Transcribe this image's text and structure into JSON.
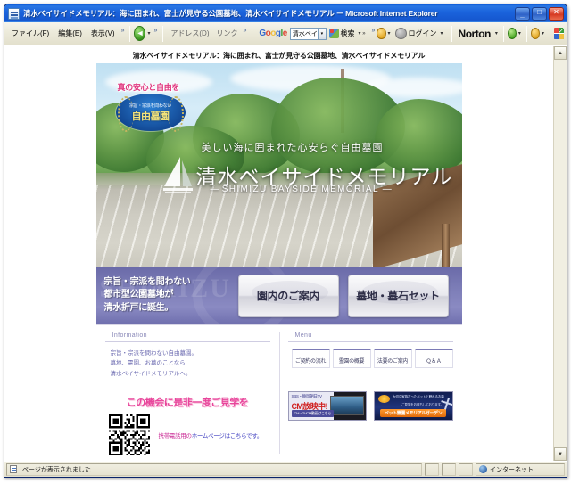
{
  "window": {
    "title": "清水ベイサイドメモリアル：海に囲まれ、富士が見守る公園墓地、清水ベイサイドメモリアル － Microsoft Internet Explorer",
    "minimize_label": "_",
    "maximize_label": "□",
    "close_label": "✕"
  },
  "toolbar": {
    "menus": [
      {
        "label": "ファイル(F)"
      },
      {
        "label": "編集(E)"
      },
      {
        "label": "表示(V)"
      }
    ],
    "menu_overflow": "»",
    "back_label": "◄",
    "back_dropdown": "▾",
    "address_label": "アドレス(D)",
    "links_label": "リンク",
    "address_overflow": "»",
    "google": {
      "logo": [
        "G",
        "o",
        "o",
        "g",
        "l",
        "e"
      ],
      "search_value": "清水ベイ",
      "search_dropdown": "▾",
      "search_button": "検索",
      "search_more": "▾ »",
      "tools_dropdown": "▾",
      "login_label": "ログイン",
      "login_dropdown": "▾"
    },
    "norton": {
      "label": "Norton",
      "dropdown": "▾",
      "status_dropdown": "▾",
      "identity_dropdown": "▾"
    }
  },
  "page": {
    "heading": "清水ベイサイドメモリアル：海に囲まれ、富士が見守る公園墓地、清水ベイサイドメモリアル",
    "hero": {
      "catch": "真の安心と自由を",
      "seal_line1": "宗旨・宗派を問わない",
      "seal_line2": "自由墓園",
      "subtitle": "美しい海に囲まれた心安らぐ自由墓園",
      "title": "清水ベイサイドメモリアル",
      "title_en": "SHIMIZU BAYSIDE MEMORIAL",
      "title_en_dash_left": "—",
      "title_en_dash_right": "—"
    },
    "band": {
      "line1": "宗旨・宗派を問わない",
      "line2": "都市型公園墓地が",
      "line3": "清水折戸に誕生。",
      "buttons": [
        {
          "label": "園内のご案内"
        },
        {
          "label": "墓地・墓石セット"
        }
      ]
    },
    "information": {
      "heading": "Information",
      "line1": "宗旨・宗派を問わない自由墓園。",
      "line2": "墓地、霊園、お墓のことなら",
      "line3": "清水ベイサイドメモリアルへ。"
    },
    "menu": {
      "heading": "Menu",
      "items": [
        {
          "label": "ご契約の流れ"
        },
        {
          "label": "霊園の概要"
        },
        {
          "label": "法要のご案内"
        },
        {
          "label": "Ｑ＆Ａ"
        }
      ]
    },
    "promo": {
      "headline": "この機会に是非一度ご見学を",
      "mobile_link_pink": "携帯電話用の",
      "mobile_link_rest": "ホームページはこちらです。"
    },
    "banners": [
      {
        "top": "SBS・静岡朝日TV",
        "mid": "CM放映中!",
        "button": "CM・TVCM動画はこちら"
      },
      {
        "line1": "大切な家族だったペットと眠れるお墓",
        "line2": "ご見学をお待ちしております。",
        "button": "ペット霊園メモリアルガーデン"
      }
    ],
    "scrollbar": {
      "up": "▲",
      "down": "▼"
    }
  },
  "statusbar": {
    "message": "ページが表示されました",
    "zone": "インターネット"
  }
}
